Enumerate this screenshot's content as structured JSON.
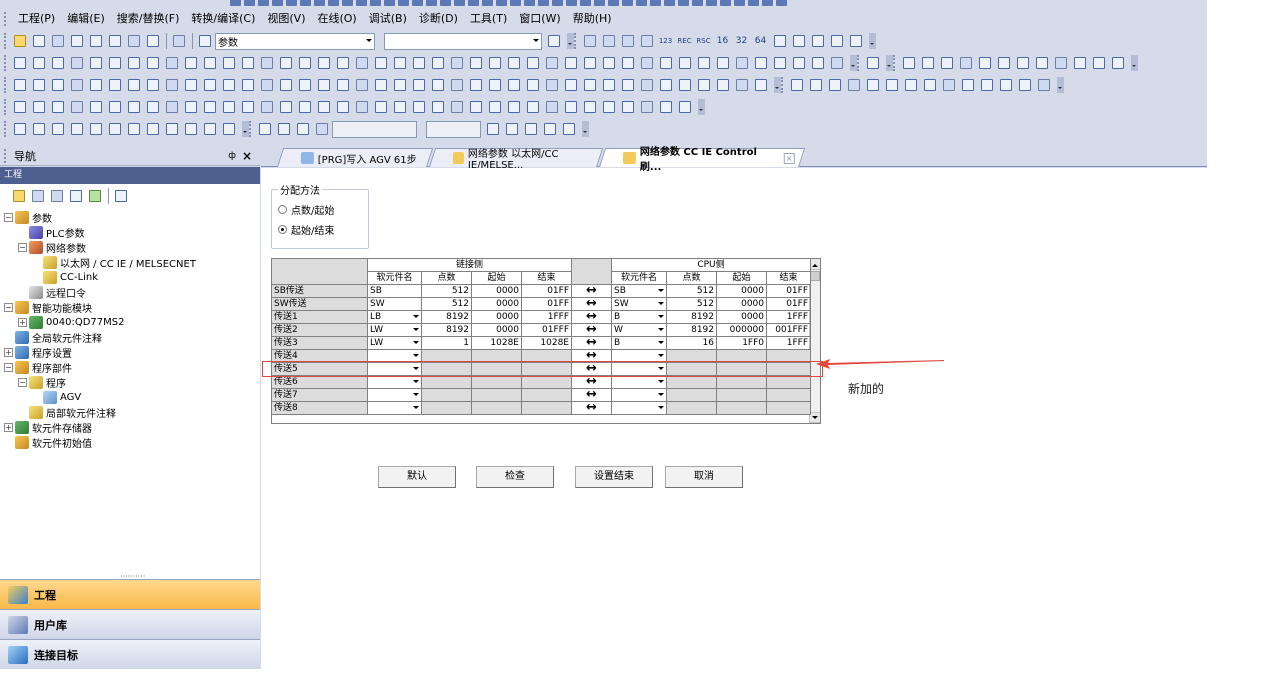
{
  "menu": [
    "工程(P)",
    "编辑(E)",
    "搜索/替换(F)",
    "转换/编译(C)",
    "视图(V)",
    "在线(O)",
    "调试(B)",
    "诊断(D)",
    "工具(T)",
    "窗口(W)",
    "帮助(H)"
  ],
  "toolbar": {
    "device_combo": "参数",
    "num_labels": [
      "123",
      "REC",
      "RSC",
      "16",
      "32",
      "64"
    ]
  },
  "nav": {
    "title": "导航",
    "pin": "ф",
    "close": "×",
    "section": "工程",
    "tree": [
      {
        "label": "参数",
        "level": 0,
        "exp": "−",
        "icon": "c1"
      },
      {
        "label": "PLC参数",
        "level": 1,
        "exp": "",
        "icon": "c2"
      },
      {
        "label": "网络参数",
        "level": 1,
        "exp": "−",
        "icon": "c3"
      },
      {
        "label": "以太网 / CC IE / MELSECNET",
        "level": 2,
        "exp": "",
        "icon": "c7"
      },
      {
        "label": "CC-Link",
        "level": 2,
        "exp": "",
        "icon": "c7"
      },
      {
        "label": "远程口令",
        "level": 1,
        "exp": "",
        "icon": "c5"
      },
      {
        "label": "智能功能模块",
        "level": 0,
        "exp": "−",
        "icon": "c1"
      },
      {
        "label": "0040:QD77MS2",
        "level": 1,
        "exp": "+",
        "icon": "c4"
      },
      {
        "label": "全局软元件注释",
        "level": 0,
        "exp": "",
        "icon": "c6"
      },
      {
        "label": "程序设置",
        "level": 0,
        "exp": "+",
        "icon": "c6"
      },
      {
        "label": "程序部件",
        "level": 0,
        "exp": "−",
        "icon": "c1"
      },
      {
        "label": "程序",
        "level": 1,
        "exp": "−",
        "icon": "c7"
      },
      {
        "label": "AGV",
        "level": 2,
        "exp": "",
        "icon": "c8"
      },
      {
        "label": "局部软元件注释",
        "level": 1,
        "exp": "",
        "icon": "c7"
      },
      {
        "label": "软元件存储器",
        "level": 0,
        "exp": "+",
        "icon": "c4"
      },
      {
        "label": "软元件初始值",
        "level": 0,
        "exp": "",
        "icon": "c1"
      }
    ],
    "buttons": [
      "工程",
      "用户库",
      "连接目标"
    ]
  },
  "tabs": [
    {
      "label": "[PRG]写入 AGV 61步",
      "active": false
    },
    {
      "label": "网络参数 以太网/CC IE/MELSE...",
      "active": false
    },
    {
      "label": "网络参数 CC IE Control 刷...",
      "active": true
    }
  ],
  "method": {
    "legend": "分配方法",
    "options": [
      "点数/起始",
      "起始/结束"
    ],
    "selected": 1
  },
  "grid": {
    "link_side": "链接侧",
    "cpu_side": "CPU侧",
    "col_headers": [
      "软元件名",
      "点数",
      "起始",
      "结束"
    ],
    "rows": [
      {
        "name": "SB传送",
        "link": [
          "SB",
          "512",
          "0000",
          "01FF"
        ],
        "dd1": false,
        "cpu": [
          "SB",
          "512",
          "0000",
          "01FF"
        ],
        "dd2": true
      },
      {
        "name": "SW传送",
        "link": [
          "SW",
          "512",
          "0000",
          "01FF"
        ],
        "dd1": false,
        "cpu": [
          "SW",
          "512",
          "0000",
          "01FF"
        ],
        "dd2": true
      },
      {
        "name": "传送1",
        "link": [
          "LB",
          "8192",
          "0000",
          "1FFF"
        ],
        "dd1": true,
        "cpu": [
          "B",
          "8192",
          "0000",
          "1FFF"
        ],
        "dd2": true
      },
      {
        "name": "传送2",
        "link": [
          "LW",
          "8192",
          "0000",
          "01FFF"
        ],
        "dd1": true,
        "cpu": [
          "W",
          "8192",
          "000000",
          "001FFF"
        ],
        "dd2": true
      },
      {
        "name": "传送3",
        "link": [
          "LW",
          "1",
          "1028E",
          "1028E"
        ],
        "dd1": true,
        "cpu": [
          "B",
          "16",
          "1FF0",
          "1FFF"
        ],
        "dd2": true
      },
      {
        "name": "传送4",
        "link": [
          "",
          "",
          "",
          ""
        ],
        "dd1": true,
        "cpu": [
          "",
          "",
          "",
          ""
        ],
        "dd2": true
      },
      {
        "name": "传送5",
        "link": [
          "",
          "",
          "",
          ""
        ],
        "dd1": true,
        "cpu": [
          "",
          "",
          "",
          ""
        ],
        "dd2": true
      },
      {
        "name": "传送6",
        "link": [
          "",
          "",
          "",
          ""
        ],
        "dd1": true,
        "cpu": [
          "",
          "",
          "",
          ""
        ],
        "dd2": true
      },
      {
        "name": "传送7",
        "link": [
          "",
          "",
          "",
          ""
        ],
        "dd1": true,
        "cpu": [
          "",
          "",
          "",
          ""
        ],
        "dd2": true
      },
      {
        "name": "传送8",
        "link": [
          "",
          "",
          "",
          ""
        ],
        "dd1": true,
        "cpu": [
          "",
          "",
          "",
          ""
        ],
        "dd2": true
      }
    ],
    "arrow": "↔"
  },
  "annotation": "新加的",
  "buttons": [
    "默认",
    "检查",
    "设置结束",
    "取消"
  ],
  "colors": {
    "highlight": "#e2483d",
    "active_nav": "#f9b94a"
  }
}
